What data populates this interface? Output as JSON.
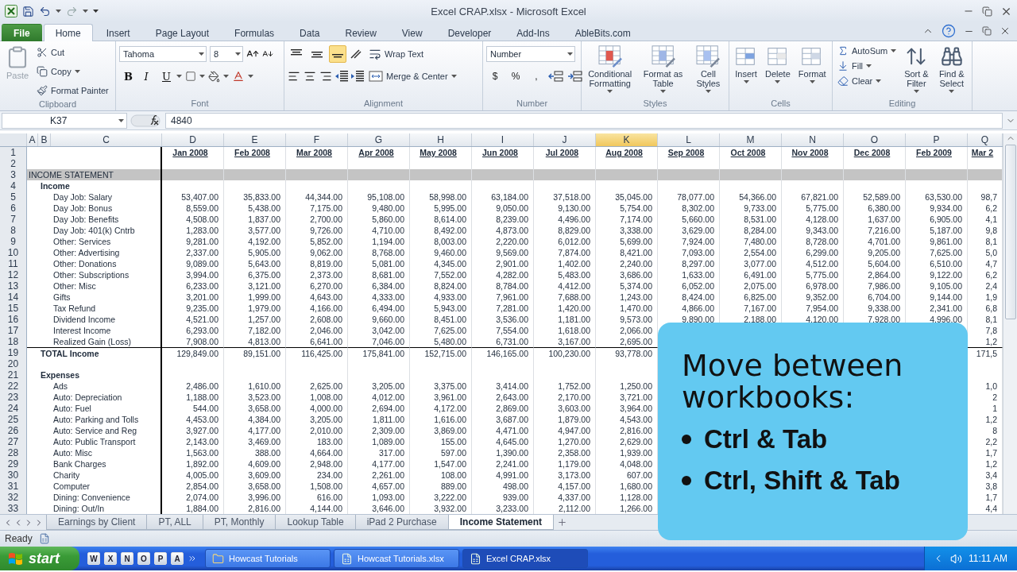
{
  "window": {
    "title": "Excel CRAP.xlsx - Microsoft Excel"
  },
  "tabs": [
    {
      "label": "File",
      "kind": "file",
      "selected": false
    },
    {
      "label": "Home",
      "kind": "tab",
      "selected": true
    },
    {
      "label": "Insert",
      "kind": "tab",
      "selected": false
    },
    {
      "label": "Page Layout",
      "kind": "tab",
      "selected": false
    },
    {
      "label": "Formulas",
      "kind": "tab",
      "selected": false
    },
    {
      "label": "Data",
      "kind": "tab",
      "selected": false
    },
    {
      "label": "Review",
      "kind": "tab",
      "selected": false
    },
    {
      "label": "View",
      "kind": "tab",
      "selected": false
    },
    {
      "label": "Developer",
      "kind": "tab",
      "selected": false
    },
    {
      "label": "Add-Ins",
      "kind": "tab",
      "selected": false
    },
    {
      "label": "AbleBits.com",
      "kind": "tab",
      "selected": false
    }
  ],
  "ribbon": {
    "clipboard": {
      "name": "Clipboard",
      "paste": {
        "label": "Paste",
        "disabled": true
      },
      "commands": [
        "Cut",
        "Copy",
        "Format Painter"
      ]
    },
    "font": {
      "name": "Font",
      "face": "Tahoma",
      "size": "8",
      "styles": [
        "B",
        "I",
        "U"
      ]
    },
    "alignment": {
      "name": "Alignment",
      "vertical": [
        {
          "selected": false
        },
        {
          "selected": false
        },
        {
          "selected": true
        }
      ],
      "wrap": "Wrap Text",
      "merge": "Merge & Center"
    },
    "number": {
      "name": "Number",
      "format": "Number",
      "symbols": [
        "$",
        "%",
        ","
      ]
    },
    "styles": {
      "name": "Styles",
      "commands": [
        "Conditional Formatting",
        "Format as Table",
        "Cell Styles"
      ]
    },
    "cells": {
      "name": "Cells",
      "commands": [
        "Insert",
        "Delete",
        "Format"
      ]
    },
    "editing": {
      "name": "Editing",
      "small": [
        "AutoSum",
        "Fill",
        "Clear"
      ],
      "large": [
        "Sort & Filter",
        "Find & Select"
      ]
    }
  },
  "formula_bar": {
    "name_box": "K37",
    "formula": "4840"
  },
  "sheet": {
    "columns": [
      {
        "letter": "A",
        "selected": false
      },
      {
        "letter": "B",
        "selected": false
      },
      {
        "letter": "C",
        "selected": false
      },
      {
        "letter": "D",
        "selected": false
      },
      {
        "letter": "E",
        "selected": false
      },
      {
        "letter": "F",
        "selected": false
      },
      {
        "letter": "G",
        "selected": false
      },
      {
        "letter": "H",
        "selected": false
      },
      {
        "letter": "I",
        "selected": false
      },
      {
        "letter": "J",
        "selected": false
      },
      {
        "letter": "K",
        "selected": true
      },
      {
        "letter": "L",
        "selected": false
      },
      {
        "letter": "M",
        "selected": false
      },
      {
        "letter": "N",
        "selected": false
      },
      {
        "letter": "O",
        "selected": false
      },
      {
        "letter": "P",
        "selected": false
      },
      {
        "letter": "Q",
        "selected": false
      }
    ],
    "rows": [
      {
        "num": "1",
        "kind": "months",
        "cells": [
          "Jan 2008",
          "Feb 2008",
          "Mar 2008",
          "Apr 2008",
          "May 2008",
          "Jun 2008",
          "Jul 2008",
          "Aug 2008",
          "Sep 2008",
          "Oct 2008",
          "Nov 2008",
          "Dec 2008",
          "Feb 2009",
          "Mar 2"
        ]
      },
      {
        "num": "2",
        "kind": "blank"
      },
      {
        "num": "3",
        "kind": "section",
        "label": "INCOME STATEMENT"
      },
      {
        "num": "4",
        "kind": "group",
        "label": "Income"
      },
      {
        "num": "5",
        "kind": "item",
        "label": "Day Job: Salary",
        "cells": [
          "53,407.00",
          "35,833.00",
          "44,344.00",
          "95,108.00",
          "58,998.00",
          "63,184.00",
          "37,518.00",
          "35,045.00",
          "78,077.00",
          "54,366.00",
          "67,821.00",
          "52,589.00",
          "63,530.00",
          "98,7"
        ]
      },
      {
        "num": "6",
        "kind": "item",
        "label": "Day Job: Bonus",
        "cells": [
          "8,559.00",
          "5,438.00",
          "7,175.00",
          "9,480.00",
          "5,995.00",
          "9,050.00",
          "9,130.00",
          "5,754.00",
          "8,302.00",
          "9,733.00",
          "5,775.00",
          "6,380.00",
          "9,934.00",
          "6,2"
        ]
      },
      {
        "num": "7",
        "kind": "item",
        "label": "Day Job: Benefits",
        "cells": [
          "4,508.00",
          "1,837.00",
          "2,700.00",
          "5,860.00",
          "8,614.00",
          "8,239.00",
          "4,496.00",
          "7,174.00",
          "5,660.00",
          "8,531.00",
          "4,128.00",
          "1,637.00",
          "6,905.00",
          "4,1"
        ]
      },
      {
        "num": "8",
        "kind": "item",
        "label": "Day Job: 401(k) Cntrb",
        "cells": [
          "1,283.00",
          "3,577.00",
          "9,726.00",
          "4,710.00",
          "8,492.00",
          "4,873.00",
          "8,829.00",
          "3,338.00",
          "3,629.00",
          "8,284.00",
          "9,343.00",
          "7,216.00",
          "5,187.00",
          "9,8"
        ]
      },
      {
        "num": "9",
        "kind": "item",
        "label": "Other: Services",
        "cells": [
          "9,281.00",
          "4,192.00",
          "5,852.00",
          "1,194.00",
          "8,003.00",
          "2,220.00",
          "6,012.00",
          "5,699.00",
          "7,924.00",
          "7,480.00",
          "8,728.00",
          "4,701.00",
          "9,861.00",
          "8,1"
        ]
      },
      {
        "num": "10",
        "kind": "item",
        "label": "Other: Advertising",
        "cells": [
          "2,337.00",
          "5,905.00",
          "9,062.00",
          "8,768.00",
          "9,460.00",
          "9,569.00",
          "7,874.00",
          "8,421.00",
          "7,093.00",
          "2,554.00",
          "6,299.00",
          "9,205.00",
          "7,625.00",
          "5,0"
        ]
      },
      {
        "num": "11",
        "kind": "item",
        "label": "Other: Donations",
        "cells": [
          "9,089.00",
          "5,643.00",
          "8,819.00",
          "5,081.00",
          "4,345.00",
          "2,901.00",
          "1,402.00",
          "2,240.00",
          "8,297.00",
          "3,077.00",
          "4,512.00",
          "5,604.00",
          "6,510.00",
          "4,7"
        ]
      },
      {
        "num": "12",
        "kind": "item",
        "label": "Other: Subscriptions",
        "cells": [
          "3,994.00",
          "6,375.00",
          "2,373.00",
          "8,681.00",
          "7,552.00",
          "4,282.00",
          "5,483.00",
          "3,686.00",
          "1,633.00",
          "6,491.00",
          "5,775.00",
          "2,864.00",
          "9,122.00",
          "6,2"
        ]
      },
      {
        "num": "13",
        "kind": "item",
        "label": "Other: Misc",
        "cells": [
          "6,233.00",
          "3,121.00",
          "6,270.00",
          "6,384.00",
          "8,824.00",
          "8,784.00",
          "4,412.00",
          "5,374.00",
          "6,052.00",
          "2,075.00",
          "6,978.00",
          "7,986.00",
          "9,105.00",
          "2,4"
        ]
      },
      {
        "num": "14",
        "kind": "item",
        "label": "Gifts",
        "cells": [
          "3,201.00",
          "1,999.00",
          "4,643.00",
          "4,333.00",
          "4,933.00",
          "7,961.00",
          "7,688.00",
          "1,243.00",
          "8,424.00",
          "6,825.00",
          "9,352.00",
          "6,704.00",
          "9,144.00",
          "1,9"
        ]
      },
      {
        "num": "15",
        "kind": "item",
        "label": "Tax Refund",
        "cells": [
          "9,235.00",
          "1,979.00",
          "4,166.00",
          "6,494.00",
          "5,943.00",
          "7,281.00",
          "1,420.00",
          "1,470.00",
          "4,866.00",
          "7,167.00",
          "7,954.00",
          "9,338.00",
          "2,341.00",
          "6,8"
        ]
      },
      {
        "num": "16",
        "kind": "item",
        "label": "Dividend Income",
        "cells": [
          "4,521.00",
          "1,257.00",
          "2,608.00",
          "9,660.00",
          "8,451.00",
          "3,536.00",
          "1,181.00",
          "9,573.00",
          "9,890.00",
          "2,188.00",
          "4,120.00",
          "7,928.00",
          "4,996.00",
          "8,1"
        ]
      },
      {
        "num": "17",
        "kind": "item",
        "label": "Interest Income",
        "cells": [
          "6,293.00",
          "7,182.00",
          "2,046.00",
          "3,042.00",
          "7,625.00",
          "7,554.00",
          "1,618.00",
          "2,066.00",
          null,
          null,
          null,
          null,
          null,
          "7,8"
        ]
      },
      {
        "num": "18",
        "kind": "item",
        "label": "Realized Gain (Loss)",
        "cells": [
          "7,908.00",
          "4,813.00",
          "6,641.00",
          "7,046.00",
          "5,480.00",
          "6,731.00",
          "3,167.00",
          "2,695.00",
          null,
          null,
          null,
          null,
          null,
          "1,2"
        ]
      },
      {
        "num": "19",
        "kind": "total",
        "label": "TOTAL Income",
        "cells": [
          "129,849.00",
          "89,151.00",
          "116,425.00",
          "175,841.00",
          "152,715.00",
          "146,165.00",
          "100,230.00",
          "93,778.00",
          null,
          null,
          null,
          null,
          null,
          "171,5"
        ]
      },
      {
        "num": "20",
        "kind": "blank"
      },
      {
        "num": "21",
        "kind": "group",
        "label": "Expenses"
      },
      {
        "num": "22",
        "kind": "item",
        "label": "Ads",
        "cells": [
          "2,486.00",
          "1,610.00",
          "2,625.00",
          "3,205.00",
          "3,375.00",
          "3,414.00",
          "1,752.00",
          "1,250.00",
          null,
          null,
          null,
          null,
          null,
          "1,0"
        ]
      },
      {
        "num": "23",
        "kind": "item",
        "label": "Auto: Depreciation",
        "cells": [
          "1,188.00",
          "3,523.00",
          "1,008.00",
          "4,012.00",
          "3,961.00",
          "2,643.00",
          "2,170.00",
          "3,721.00",
          null,
          null,
          null,
          null,
          null,
          "2"
        ]
      },
      {
        "num": "24",
        "kind": "item",
        "label": "Auto: Fuel",
        "cells": [
          "544.00",
          "3,658.00",
          "4,000.00",
          "2,694.00",
          "4,172.00",
          "2,869.00",
          "3,603.00",
          "3,964.00",
          null,
          null,
          null,
          null,
          null,
          "1"
        ]
      },
      {
        "num": "25",
        "kind": "item",
        "label": "Auto: Parking and Tolls",
        "cells": [
          "4,453.00",
          "4,384.00",
          "3,205.00",
          "1,811.00",
          "1,616.00",
          "3,687.00",
          "1,879.00",
          "4,543.00",
          null,
          null,
          null,
          null,
          null,
          "1,2"
        ]
      },
      {
        "num": "26",
        "kind": "item",
        "label": "Auto: Service and Reg",
        "cells": [
          "3,927.00",
          "4,177.00",
          "2,010.00",
          "2,309.00",
          "3,869.00",
          "4,471.00",
          "4,947.00",
          "2,816.00",
          null,
          null,
          null,
          null,
          null,
          "8"
        ]
      },
      {
        "num": "27",
        "kind": "item",
        "label": "Auto: Public Transport",
        "cells": [
          "2,143.00",
          "3,469.00",
          "183.00",
          "1,089.00",
          "155.00",
          "4,645.00",
          "1,270.00",
          "2,629.00",
          null,
          null,
          null,
          null,
          null,
          "2,2"
        ]
      },
      {
        "num": "28",
        "kind": "item",
        "label": "Auto: Misc",
        "cells": [
          "1,563.00",
          "388.00",
          "4,664.00",
          "317.00",
          "597.00",
          "1,390.00",
          "2,358.00",
          "1,939.00",
          null,
          null,
          null,
          null,
          null,
          "1,7"
        ]
      },
      {
        "num": "29",
        "kind": "item",
        "label": "Bank Charges",
        "cells": [
          "1,892.00",
          "4,609.00",
          "2,948.00",
          "4,177.00",
          "1,547.00",
          "2,241.00",
          "1,179.00",
          "4,048.00",
          null,
          null,
          null,
          null,
          null,
          "1,2"
        ]
      },
      {
        "num": "30",
        "kind": "item",
        "label": "Charity",
        "cells": [
          "4,005.00",
          "3,609.00",
          "234.00",
          "2,261.00",
          "108.00",
          "4,991.00",
          "3,173.00",
          "607.00",
          null,
          null,
          null,
          null,
          null,
          "3,4"
        ]
      },
      {
        "num": "31",
        "kind": "item",
        "label": "Computer",
        "cells": [
          "2,854.00",
          "3,658.00",
          "1,508.00",
          "4,657.00",
          "889.00",
          "498.00",
          "4,157.00",
          "1,680.00",
          null,
          null,
          null,
          null,
          null,
          "3,8"
        ]
      },
      {
        "num": "32",
        "kind": "item",
        "label": "Dining: Convenience",
        "cells": [
          "2,074.00",
          "3,996.00",
          "616.00",
          "1,093.00",
          "3,222.00",
          "939.00",
          "4,337.00",
          "1,128.00",
          null,
          null,
          null,
          null,
          null,
          "1,7"
        ]
      },
      {
        "num": "33",
        "kind": "item",
        "label": "Dining: Out/In",
        "cells": [
          "1,884.00",
          "2,816.00",
          "4,144.00",
          "3,646.00",
          "3,932.00",
          "3,233.00",
          "2,112.00",
          "1,266.00",
          null,
          null,
          null,
          null,
          null,
          "4,4"
        ]
      }
    ]
  },
  "sheet_tabs": [
    {
      "label": "Earnings by Client",
      "selected": false
    },
    {
      "label": "PT, ALL",
      "selected": false
    },
    {
      "label": "PT, Monthly",
      "selected": false
    },
    {
      "label": "Lookup Table",
      "selected": false
    },
    {
      "label": "iPad 2 Purchase",
      "selected": false
    },
    {
      "label": "Income Statement",
      "selected": true
    }
  ],
  "status_bar": {
    "mode": "Ready"
  },
  "taskbar": {
    "start": "start",
    "quick_launch": [
      "W",
      "X",
      "N",
      "O",
      "P",
      "A"
    ],
    "tasks": [
      {
        "label": "Howcast Tutorials",
        "kind": "folder",
        "selected": false
      },
      {
        "label": "Howcast Tutorials.xlsx",
        "kind": "workbook",
        "selected": false
      },
      {
        "label": "Excel CRAP.xlsx",
        "kind": "workbook",
        "selected": true
      }
    ],
    "clock": "11:11 AM"
  },
  "overlay": {
    "title": "Move between workbooks:",
    "bullets": [
      "Ctrl & Tab",
      "Ctrl, Shift & Tab"
    ]
  }
}
